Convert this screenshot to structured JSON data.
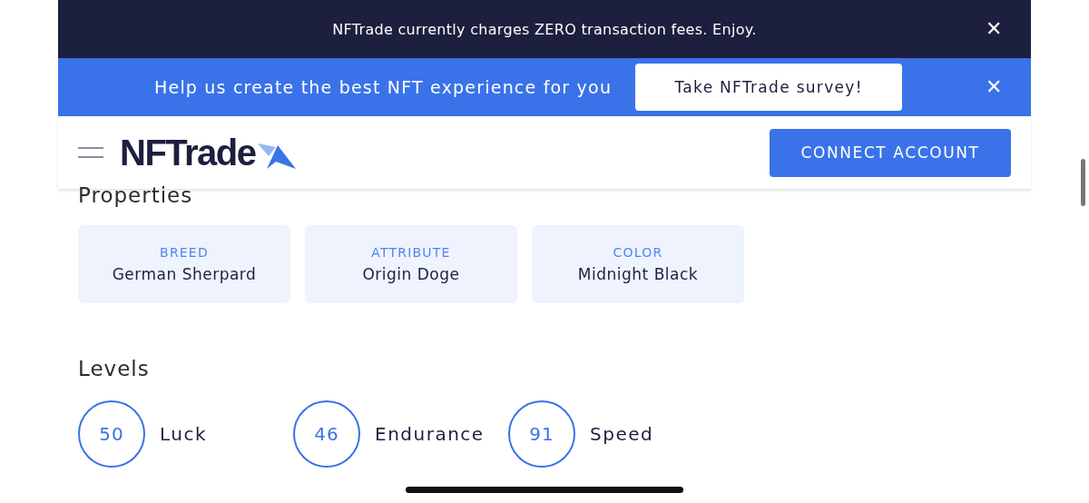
{
  "announcement": {
    "text": "NFTrade currently charges ZERO transaction fees. Enjoy.",
    "close": "✕"
  },
  "survey_banner": {
    "text": "Help us create the best NFT experience for you",
    "button": "Take NFTrade survey!",
    "close": "✕"
  },
  "header": {
    "logo": "NFTrade",
    "button": "CONNECT ACCOUNT"
  },
  "properties": {
    "title": "Properties",
    "items": [
      {
        "label": "BREED",
        "value": "German Sherpard"
      },
      {
        "label": "ATTRIBUTE",
        "value": "Origin Doge"
      },
      {
        "label": "COLOR",
        "value": "Midnight Black"
      }
    ]
  },
  "levels": {
    "title": "Levels",
    "items": [
      {
        "value": "50",
        "name": "Luck"
      },
      {
        "value": "46",
        "name": "Endurance"
      },
      {
        "value": "91",
        "name": "Speed"
      }
    ]
  }
}
